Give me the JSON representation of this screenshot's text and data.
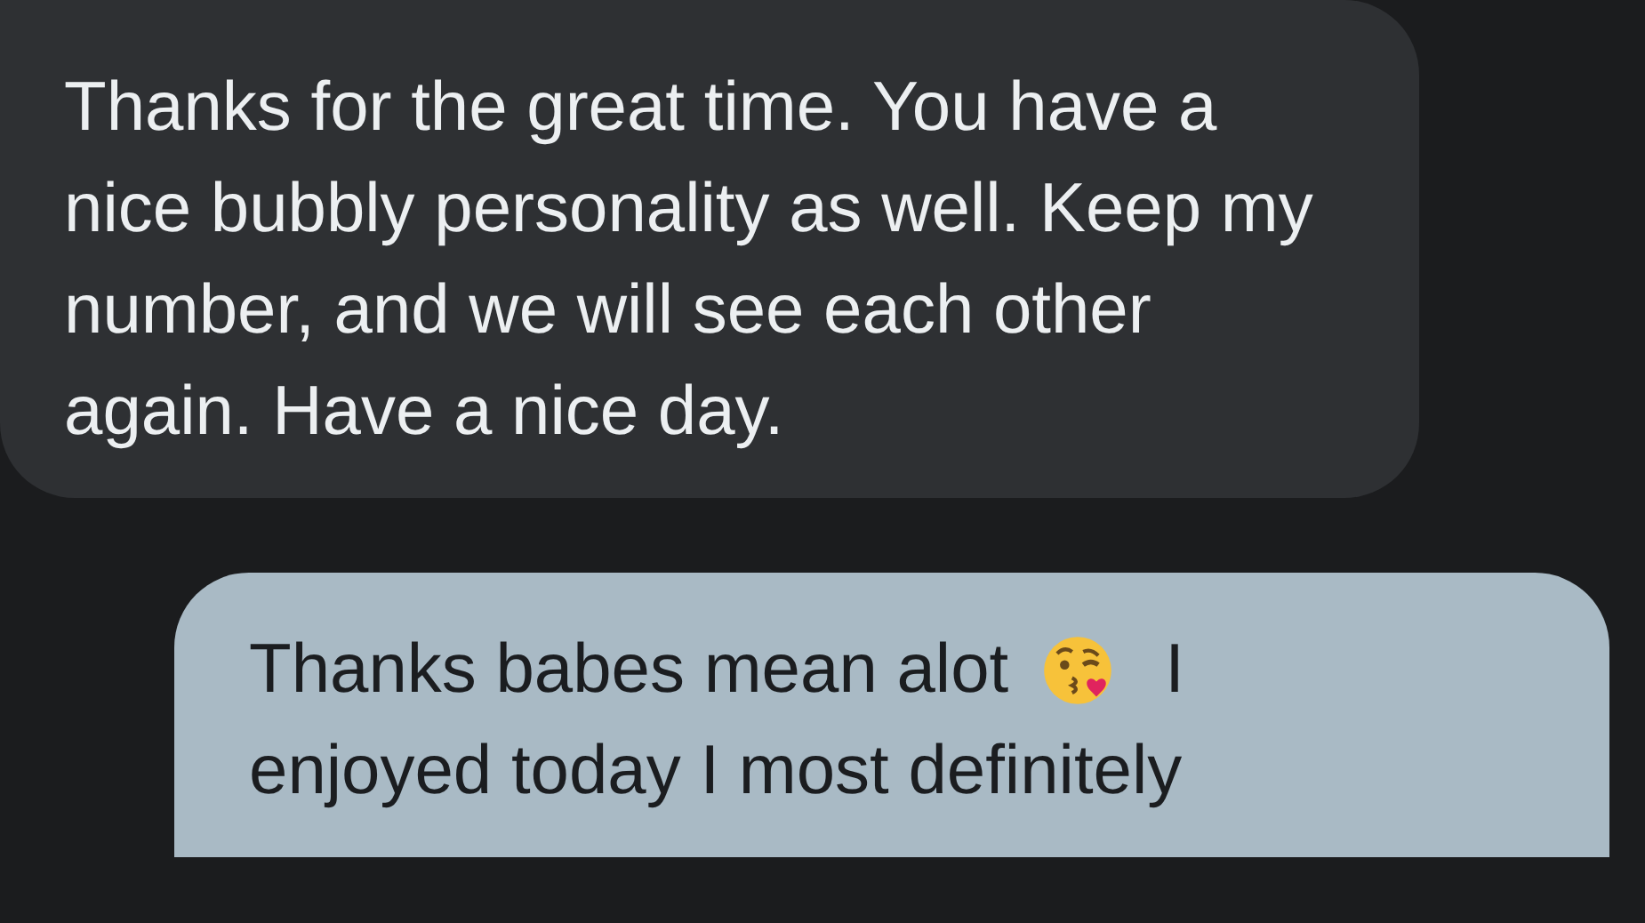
{
  "messages": [
    {
      "kind": "incoming",
      "lines": [
        [
          {
            "kind": "text",
            "text": "Thanks for the great time. You have a nice bubbly personality as well. Keep my number, and we will see each other again. Have a nice day."
          }
        ]
      ]
    },
    {
      "kind": "outgoing",
      "lines": [
        [
          {
            "kind": "text",
            "text": "Thanks babes mean alot"
          },
          {
            "kind": "emoji"
          },
          {
            "kind": "text",
            "text": "I"
          }
        ],
        [
          {
            "kind": "text",
            "text": "enjoyed today I most definitely"
          }
        ]
      ]
    }
  ]
}
